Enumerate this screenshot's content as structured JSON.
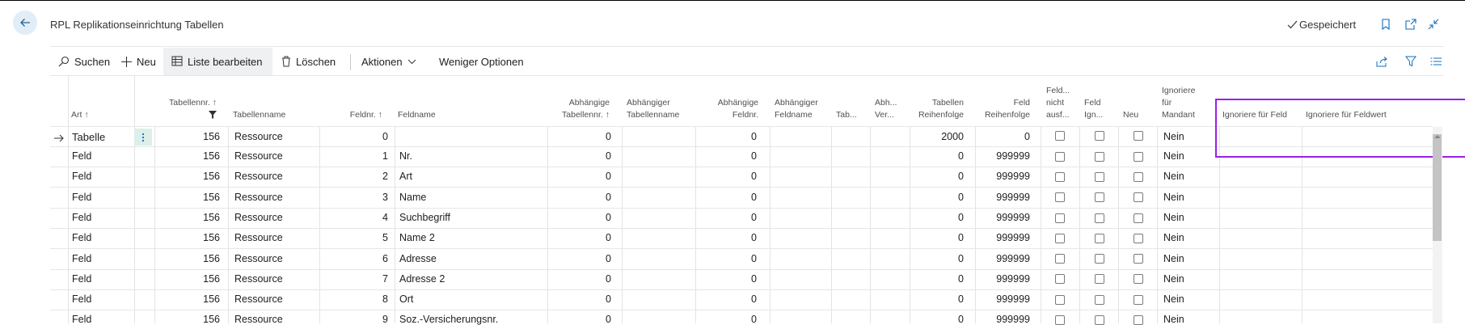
{
  "header": {
    "title": "RPL Replikationseinrichtung Tabellen",
    "saved_label": "Gespeichert"
  },
  "actions": {
    "search": "Suchen",
    "new": "Neu",
    "edit_list": "Liste bearbeiten",
    "delete": "Löschen",
    "actions": "Aktionen",
    "fewer_options": "Weniger Optionen"
  },
  "columns": {
    "art": [
      "Art ↑"
    ],
    "tablenr": [
      "Tabellennr. ↑"
    ],
    "tablename": [
      "Tabellenname"
    ],
    "feldnr": [
      "Feldnr. ↑"
    ],
    "feldname": [
      "Feldname"
    ],
    "abh_tablenr": [
      "Abhängige",
      "Tabellennr. ↑"
    ],
    "abh_tablename": [
      "Abhängiger",
      "Tabellenname"
    ],
    "abh_feldnr": [
      "Abhängige",
      "Feldnr."
    ],
    "abh_feldname": [
      "Abhängiger",
      "Feldname"
    ],
    "tab": [
      "Tab..."
    ],
    "abh_ver": [
      "Abh...",
      "Ver..."
    ],
    "tab_reihenfolge": [
      "Tabellen",
      "Reihenfolge"
    ],
    "feld_reihenfolge": [
      "Feld",
      "Reihenfolge"
    ],
    "feld_nicht": [
      "Feld...",
      "nicht",
      "ausf..."
    ],
    "feld_ign": [
      "Feld",
      "Ign..."
    ],
    "neu": [
      "Neu"
    ],
    "ign_mandant": [
      "Ignoriere",
      "für",
      "Mandant"
    ],
    "ign_feld": [
      "Ignoriere für Feld"
    ],
    "ign_feldwert": [
      "Ignoriere für Feldwert"
    ]
  },
  "rows": [
    {
      "art": "Tabelle",
      "tablenr": "156",
      "tablename": "Ressource",
      "feldnr": "0",
      "feldname": "",
      "abh_tablenr": "0",
      "abh_feldnr": "0",
      "tab_reihenfolge": "2000",
      "feld_reihenfolge": "0",
      "mandant": "Nein"
    },
    {
      "art": "Feld",
      "tablenr": "156",
      "tablename": "Ressource",
      "feldnr": "1",
      "feldname": "Nr.",
      "abh_tablenr": "0",
      "abh_feldnr": "0",
      "tab_reihenfolge": "0",
      "feld_reihenfolge": "999999",
      "mandant": "Nein"
    },
    {
      "art": "Feld",
      "tablenr": "156",
      "tablename": "Ressource",
      "feldnr": "2",
      "feldname": "Art",
      "abh_tablenr": "0",
      "abh_feldnr": "0",
      "tab_reihenfolge": "0",
      "feld_reihenfolge": "999999",
      "mandant": "Nein"
    },
    {
      "art": "Feld",
      "tablenr": "156",
      "tablename": "Ressource",
      "feldnr": "3",
      "feldname": "Name",
      "abh_tablenr": "0",
      "abh_feldnr": "0",
      "tab_reihenfolge": "0",
      "feld_reihenfolge": "999999",
      "mandant": "Nein"
    },
    {
      "art": "Feld",
      "tablenr": "156",
      "tablename": "Ressource",
      "feldnr": "4",
      "feldname": "Suchbegriff",
      "abh_tablenr": "0",
      "abh_feldnr": "0",
      "tab_reihenfolge": "0",
      "feld_reihenfolge": "999999",
      "mandant": "Nein"
    },
    {
      "art": "Feld",
      "tablenr": "156",
      "tablename": "Ressource",
      "feldnr": "5",
      "feldname": "Name 2",
      "abh_tablenr": "0",
      "abh_feldnr": "0",
      "tab_reihenfolge": "0",
      "feld_reihenfolge": "999999",
      "mandant": "Nein"
    },
    {
      "art": "Feld",
      "tablenr": "156",
      "tablename": "Ressource",
      "feldnr": "6",
      "feldname": "Adresse",
      "abh_tablenr": "0",
      "abh_feldnr": "0",
      "tab_reihenfolge": "0",
      "feld_reihenfolge": "999999",
      "mandant": "Nein"
    },
    {
      "art": "Feld",
      "tablenr": "156",
      "tablename": "Ressource",
      "feldnr": "7",
      "feldname": "Adresse 2",
      "abh_tablenr": "0",
      "abh_feldnr": "0",
      "tab_reihenfolge": "0",
      "feld_reihenfolge": "999999",
      "mandant": "Nein"
    },
    {
      "art": "Feld",
      "tablenr": "156",
      "tablename": "Ressource",
      "feldnr": "8",
      "feldname": "Ort",
      "abh_tablenr": "0",
      "abh_feldnr": "0",
      "tab_reihenfolge": "0",
      "feld_reihenfolge": "999999",
      "mandant": "Nein"
    },
    {
      "art": "Feld",
      "tablenr": "156",
      "tablename": "Ressource",
      "feldnr": "9",
      "feldname": "Soz.-Versicherungsnr.",
      "abh_tablenr": "0",
      "abh_feldnr": "0",
      "tab_reihenfolge": "0",
      "feld_reihenfolge": "999999",
      "mandant": "Nein"
    }
  ],
  "colors": {
    "highlight": "#9b1fe8",
    "accent": "#0f6cbd",
    "selected_btn": "#dcefe9"
  }
}
